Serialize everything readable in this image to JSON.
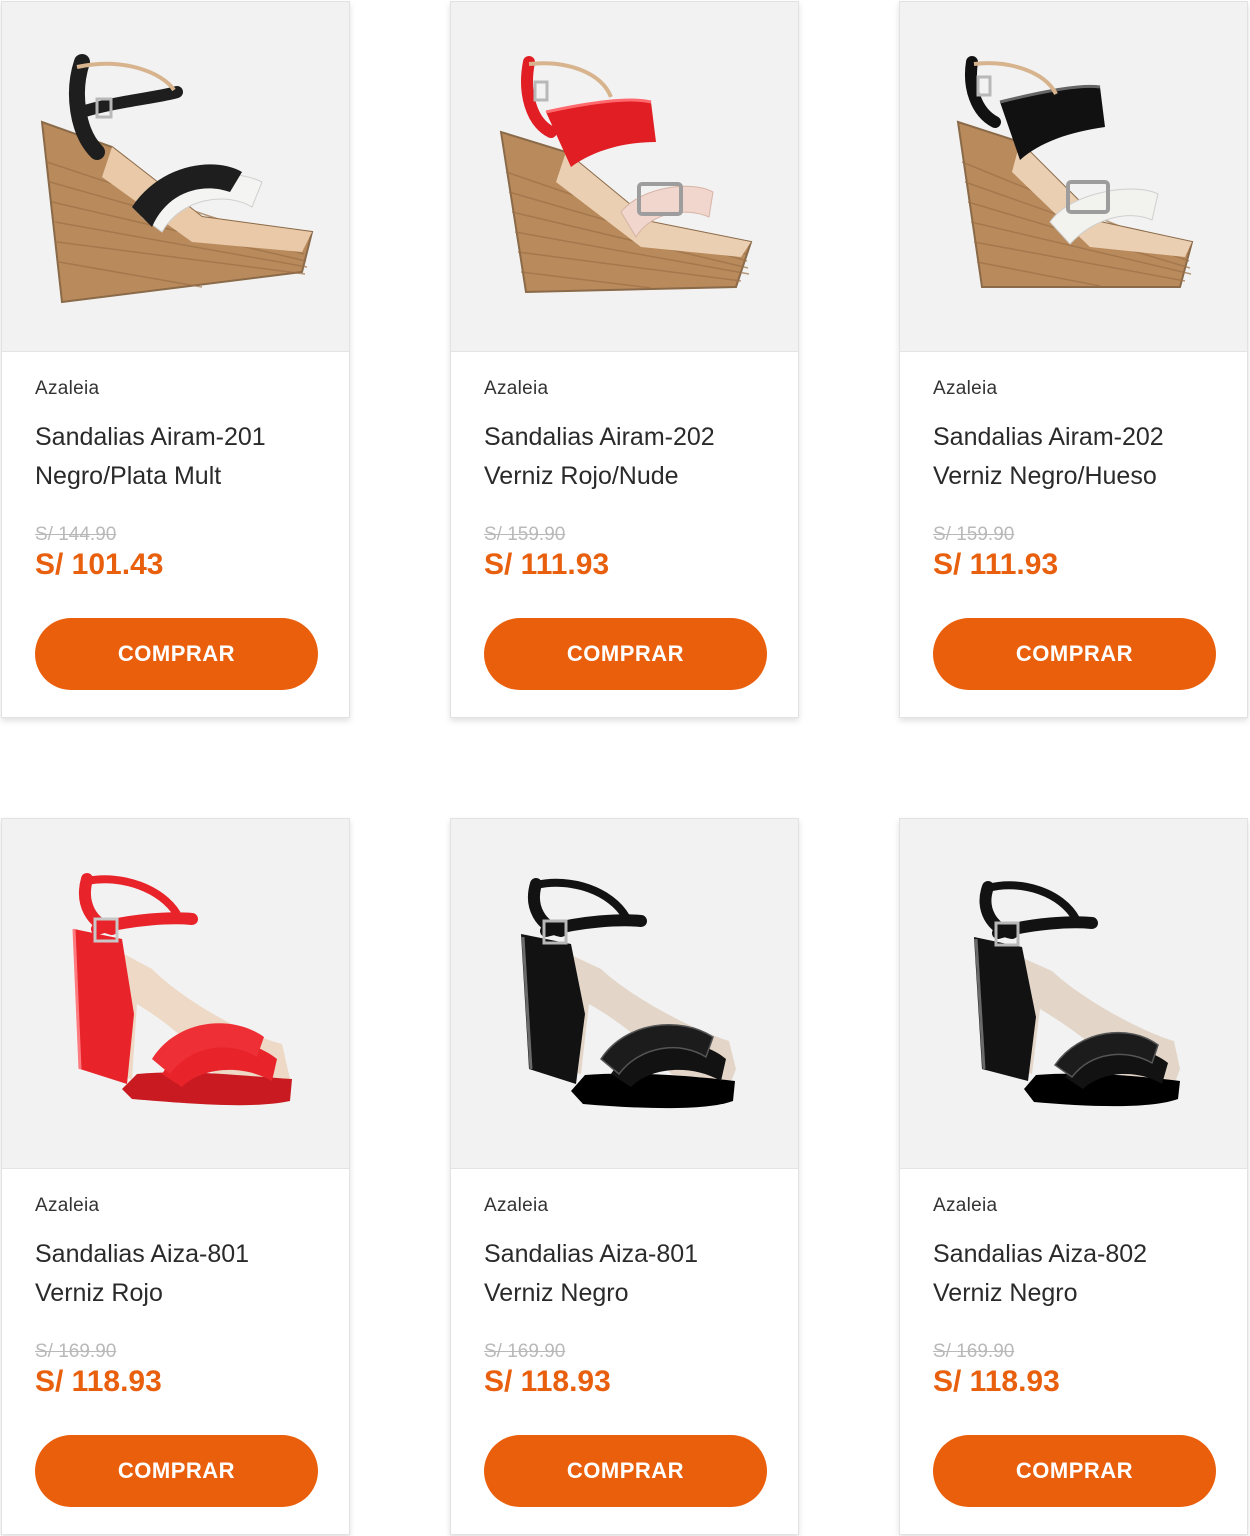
{
  "products": [
    {
      "brand": "Azaleia",
      "name_line1": "Sandalias Airam-201",
      "name_line2": "Negro/Plata Mult",
      "old_price": "S/ 144.90",
      "price": "S/ 101.43",
      "button": "COMPRAR",
      "image": "wedge-sandal-icon",
      "colors": {
        "strap": "#1e1e1e",
        "strap2": "#f4f4f2",
        "accent": "#8a6a48"
      }
    },
    {
      "brand": "Azaleia",
      "name_line1": "Sandalias Airam-202",
      "name_line2": "Verniz Rojo/Nude",
      "old_price": "S/ 159.90",
      "price": "S/ 111.93",
      "button": "COMPRAR",
      "image": "wedge-sandal-icon",
      "colors": {
        "strap": "#e01e24",
        "strap2": "#f0d6cc",
        "accent": "#e01e24"
      }
    },
    {
      "brand": "Azaleia",
      "name_line1": "Sandalias Airam-202",
      "name_line2": "Verniz Negro/Hueso",
      "old_price": "S/ 159.90",
      "price": "S/ 111.93",
      "button": "COMPRAR",
      "image": "wedge-sandal-icon",
      "colors": {
        "strap": "#111111",
        "strap2": "#f2f2ee",
        "accent": "#111111"
      }
    },
    {
      "brand": "Azaleia",
      "name_line1": "Sandalias Aiza-801",
      "name_line2": "Verniz Rojo",
      "old_price": "S/ 169.90",
      "price": "S/ 118.93",
      "button": "COMPRAR",
      "image": "block-heel-sandal-icon",
      "colors": {
        "strap": "#e8242a",
        "strap2": "#e8242a",
        "accent": "#c81a20"
      }
    },
    {
      "brand": "Azaleia",
      "name_line1": "Sandalias Aiza-801",
      "name_line2": "Verniz Negro",
      "old_price": "S/ 169.90",
      "price": "S/ 118.93",
      "button": "COMPRAR",
      "image": "block-heel-sandal-icon",
      "colors": {
        "strap": "#121212",
        "strap2": "#121212",
        "accent": "#000000"
      }
    },
    {
      "brand": "Azaleia",
      "name_line1": "Sandalias Aiza-802",
      "name_line2": "Verniz Negro",
      "old_price": "S/ 169.90",
      "price": "S/ 118.93",
      "button": "COMPRAR",
      "image": "block-heel-sandal-icon",
      "colors": {
        "strap": "#121212",
        "strap2": "#121212",
        "accent": "#000000"
      }
    }
  ],
  "theme": {
    "accent": "#ea5f0c",
    "price_color": "#e8600e"
  }
}
